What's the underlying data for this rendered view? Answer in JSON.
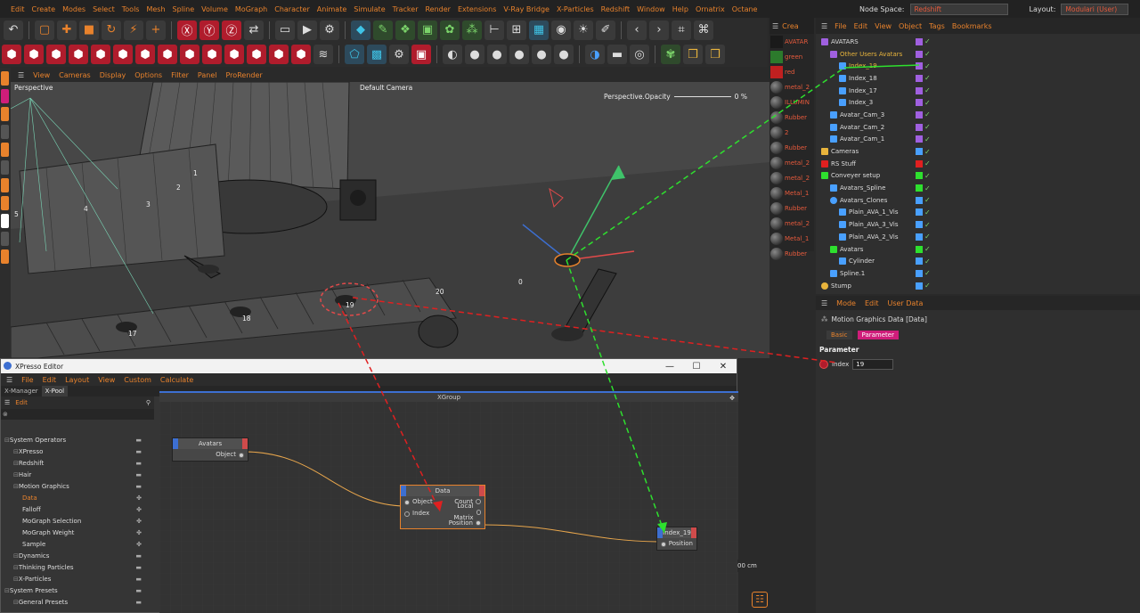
{
  "menu": {
    "items": [
      "Edit",
      "Create",
      "Modes",
      "Select",
      "Tools",
      "Mesh",
      "Spline",
      "Volume",
      "MoGraph",
      "Character",
      "Animate",
      "Simulate",
      "Tracker",
      "Render",
      "Extensions",
      "V-Ray Bridge",
      "X-Particles",
      "Redshift",
      "Window",
      "Help",
      "Ornatrix",
      "Octane"
    ]
  },
  "header": {
    "node_space_label": "Node Space:",
    "node_space_value": "Redshift",
    "layout_label": "Layout:",
    "layout_value": "Modulari (User)"
  },
  "viewport": {
    "menu": [
      "View",
      "Cameras",
      "Display",
      "Options",
      "Filter",
      "Panel",
      "ProRender"
    ],
    "name": "Perspective",
    "camera": "Default Camera",
    "opacity_label": "Perspective.Opacity",
    "opacity_value": "0 %",
    "numbers": [
      "1",
      "2",
      "3",
      "4",
      "5",
      "19",
      "20",
      "0",
      "18",
      "17"
    ]
  },
  "materials": {
    "header": "Crea",
    "items": [
      "AVATAR",
      "green",
      "red",
      "metal_2",
      "ILLUMIN",
      "Rubber",
      "2",
      "Rubber",
      "metal_2",
      "metal_2",
      "Metal_1",
      "Rubber",
      "metal_2",
      "Metal_1",
      "Rubber"
    ]
  },
  "object_manager": {
    "menu": [
      "File",
      "Edit",
      "View",
      "Object",
      "Tags",
      "Bookmarks"
    ],
    "rows": [
      "AVATARS",
      "Other Users Avatars",
      "Index_19",
      "Index_18",
      "Index_17",
      "Index_3",
      "Avatar_Cam_3",
      "Avatar_Cam_2",
      "Avatar_Cam_1",
      "Cameras",
      "RS Stuff",
      "Conveyer setup",
      "Avatars_Spline",
      "Avatars_Clones",
      "Plain_AVA_1_Vis",
      "Plain_AVA_3_Vis",
      "Plain_AVA_2_Vis",
      "Avatars",
      "Cylinder",
      "Spline.1",
      "Stump"
    ]
  },
  "attributes": {
    "menu": [
      "Mode",
      "Edit",
      "User Data"
    ],
    "title": "Motion Graphics Data [Data]",
    "tabs": [
      "Basic",
      "Parameter"
    ],
    "section": "Parameter",
    "index_label": "Index",
    "index_value": "19"
  },
  "xpresso": {
    "title": "XPresso Editor",
    "menu": [
      "File",
      "Edit",
      "Layout",
      "View",
      "Custom",
      "Calculate"
    ],
    "tabs": [
      "X-Manager",
      "X-Pool"
    ],
    "edit_label": "Edit",
    "group_title": "XGroup",
    "tree": [
      "System Operators",
      "XPresso",
      "Redshift",
      "Hair",
      "Motion Graphics",
      "Data",
      "Falloff",
      "MoGraph Selection",
      "MoGraph Weight",
      "Sample",
      "Dynamics",
      "Thinking Particles",
      "X-Particles",
      "System Presets",
      "General Presets"
    ],
    "node_avatars": {
      "title": "Avatars",
      "port_out": "Object"
    },
    "node_data": {
      "title": "Data",
      "in": [
        "Object",
        "Index"
      ],
      "out": [
        "Count",
        "Local Matrix",
        "Position"
      ]
    },
    "node_index": {
      "title": "Index_19",
      "port_in": "Position"
    },
    "unit": "00 cm"
  }
}
